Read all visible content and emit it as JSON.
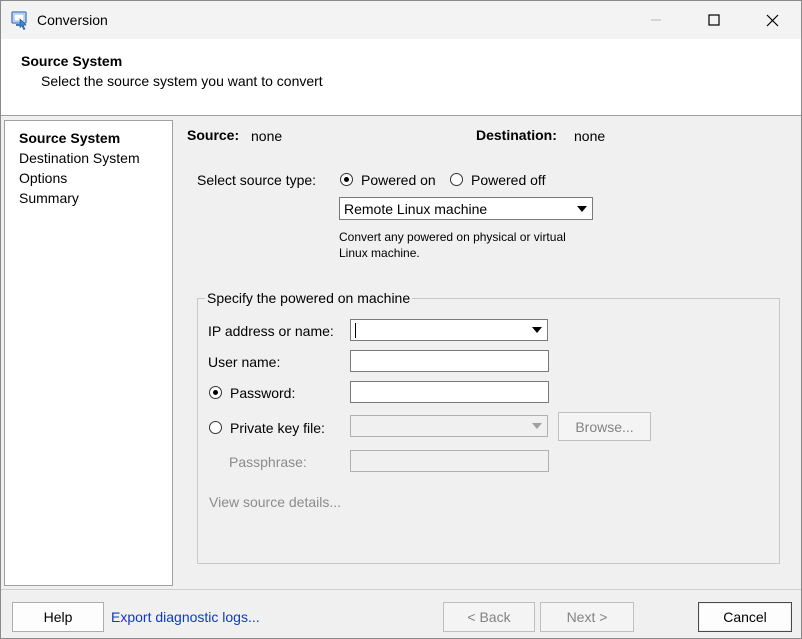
{
  "window": {
    "title": "Conversion",
    "minimize_icon": "minimize-icon",
    "maximize_icon": "maximize-icon",
    "close_icon": "close-icon"
  },
  "header": {
    "title": "Source System",
    "subtitle": "Select the source system you want to convert"
  },
  "nav": {
    "items": [
      {
        "label": "Source System",
        "active": true
      },
      {
        "label": "Destination System",
        "active": false
      },
      {
        "label": "Options",
        "active": false
      },
      {
        "label": "Summary",
        "active": false
      }
    ]
  },
  "status": {
    "source_label": "Source:",
    "source_value": "none",
    "destination_label": "Destination:",
    "destination_value": "none"
  },
  "source_type": {
    "label": "Select source type:",
    "powered_on": "Powered on",
    "powered_off": "Powered off",
    "selected": "powered_on",
    "machine_type": "Remote Linux machine",
    "description_line1": "Convert any powered on physical or virtual",
    "description_line2": "Linux machine."
  },
  "group": {
    "title": "Specify the powered on machine",
    "ip_label": "IP address or name:",
    "ip_value": "",
    "username_label": "User name:",
    "username_value": "",
    "password_label": "Password:",
    "password_value": "",
    "keyfile_label": "Private key file:",
    "keyfile_value": "",
    "browse_label": "Browse...",
    "passphrase_label": "Passphrase:",
    "passphrase_value": "",
    "auth_selected": "password",
    "view_details": "View source details..."
  },
  "footer": {
    "help": "Help",
    "export_logs": "Export diagnostic logs...",
    "back": "< Back",
    "next": "Next >",
    "cancel": "Cancel"
  },
  "colors": {
    "link": "#0b3cc1",
    "disabled_text": "#8b8b8b",
    "panel_bg": "#f0f0f0"
  }
}
